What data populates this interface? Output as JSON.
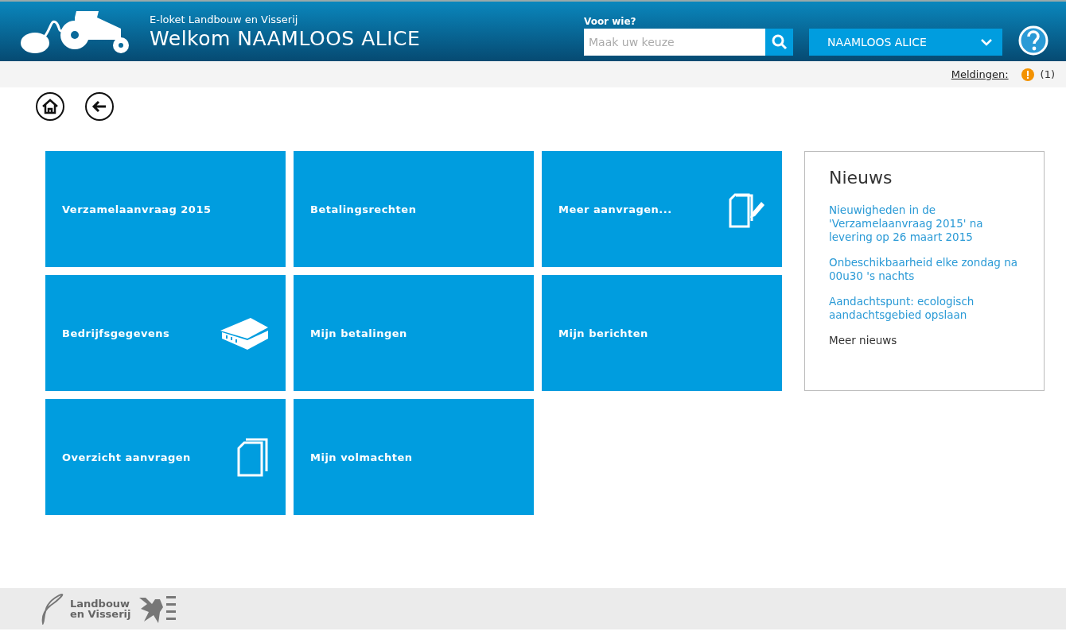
{
  "header": {
    "subtitle": "E-loket Landbouw en Visserij",
    "title": "Welkom NAAMLOOS ALICE",
    "search_label": "Voor wie?",
    "search_placeholder": "Maak uw keuze",
    "user_menu": "NAAMLOOS ALICE"
  },
  "notifications": {
    "label": "Meldingen:",
    "count": "(1)"
  },
  "tiles": [
    {
      "label": "Verzamelaanvraag 2015",
      "kind": "plain"
    },
    {
      "label": "Betalingsrechten",
      "kind": "plain"
    },
    {
      "label": "Meer aanvragen...",
      "kind": "compose"
    },
    {
      "label": "Bedrijfsgegevens",
      "kind": "company"
    },
    {
      "label": "Mijn betalingen",
      "kind": "plain"
    },
    {
      "label": "Mijn berichten",
      "kind": "plain"
    },
    {
      "label": "Overzicht aanvragen",
      "kind": "documents"
    },
    {
      "label": "Mijn volmachten",
      "kind": "plain"
    }
  ],
  "news": {
    "title": "Nieuws",
    "items": [
      "Nieuwigheden in de 'Verzamelaanvraag 2015' na levering op 26 maart 2015",
      "Onbeschikbaarheid elke zondag na 00u30 's nachts",
      "Aandachtspunt: ecologisch aandachtsgebied opslaan"
    ],
    "more": "Meer nieuws"
  },
  "footer": {
    "logo_line1": "Landbouw",
    "logo_line2": "en Visserij"
  }
}
